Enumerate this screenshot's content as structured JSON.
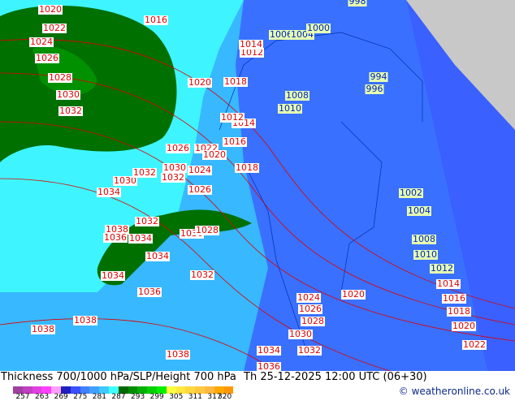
{
  "title": "Thickness 700/1000 hPa/SLP/Height 700 hPa",
  "datetime": "Th 25-12-2025 12:00 UTC (06+30)",
  "credit": "© weatheronline.co.uk",
  "colorbar": {
    "colors": [
      "#a040a0",
      "#c040c0",
      "#e040e0",
      "#ff40ff",
      "#ffa0ff",
      "#2020c0",
      "#3a50ff",
      "#4080ff",
      "#40a0ff",
      "#40c8ff",
      "#40ffff",
      "#006800",
      "#008c00",
      "#00b000",
      "#00d000",
      "#00f000",
      "#ffff40",
      "#ffe840",
      "#ffd840",
      "#ffc840",
      "#ffb840",
      "#ffa800",
      "#ff9800"
    ],
    "ticks": [
      "257",
      "263",
      "269",
      "275",
      "281",
      "287",
      "293",
      "299",
      "305",
      "311",
      "317",
      "320"
    ]
  },
  "labels": [
    "1020",
    "1022",
    "1024",
    "1026",
    "1028",
    "1030",
    "1032",
    "1016",
    "1020",
    "1026",
    "1022",
    "1020",
    "1018",
    "1016",
    "1030",
    "1032",
    "1024",
    "1026",
    "1030",
    "1032",
    "1034",
    "1032",
    "1030",
    "1028",
    "1038",
    "1036",
    "1034",
    "1034",
    "1034",
    "1036",
    "1032",
    "1038",
    "1038",
    "1038",
    "1034",
    "1036",
    "1024",
    "1026",
    "1028",
    "1030",
    "1032",
    "1020",
    "1014",
    "1016",
    "1018",
    "1020",
    "1022",
    "1018",
    "1014",
    "1012",
    "1012",
    "1014",
    "1008",
    "1010",
    "1002",
    "1004",
    "1008",
    "1010",
    "1012",
    "994",
    "996",
    "1006",
    "1004",
    "1000",
    "998"
  ],
  "colors": {
    "land_gray": "#c8c8c8",
    "sea_blue": "#3a70ff",
    "mid_blue": "#38b8ff",
    "cyan": "#40ffff",
    "green": "#007000"
  }
}
